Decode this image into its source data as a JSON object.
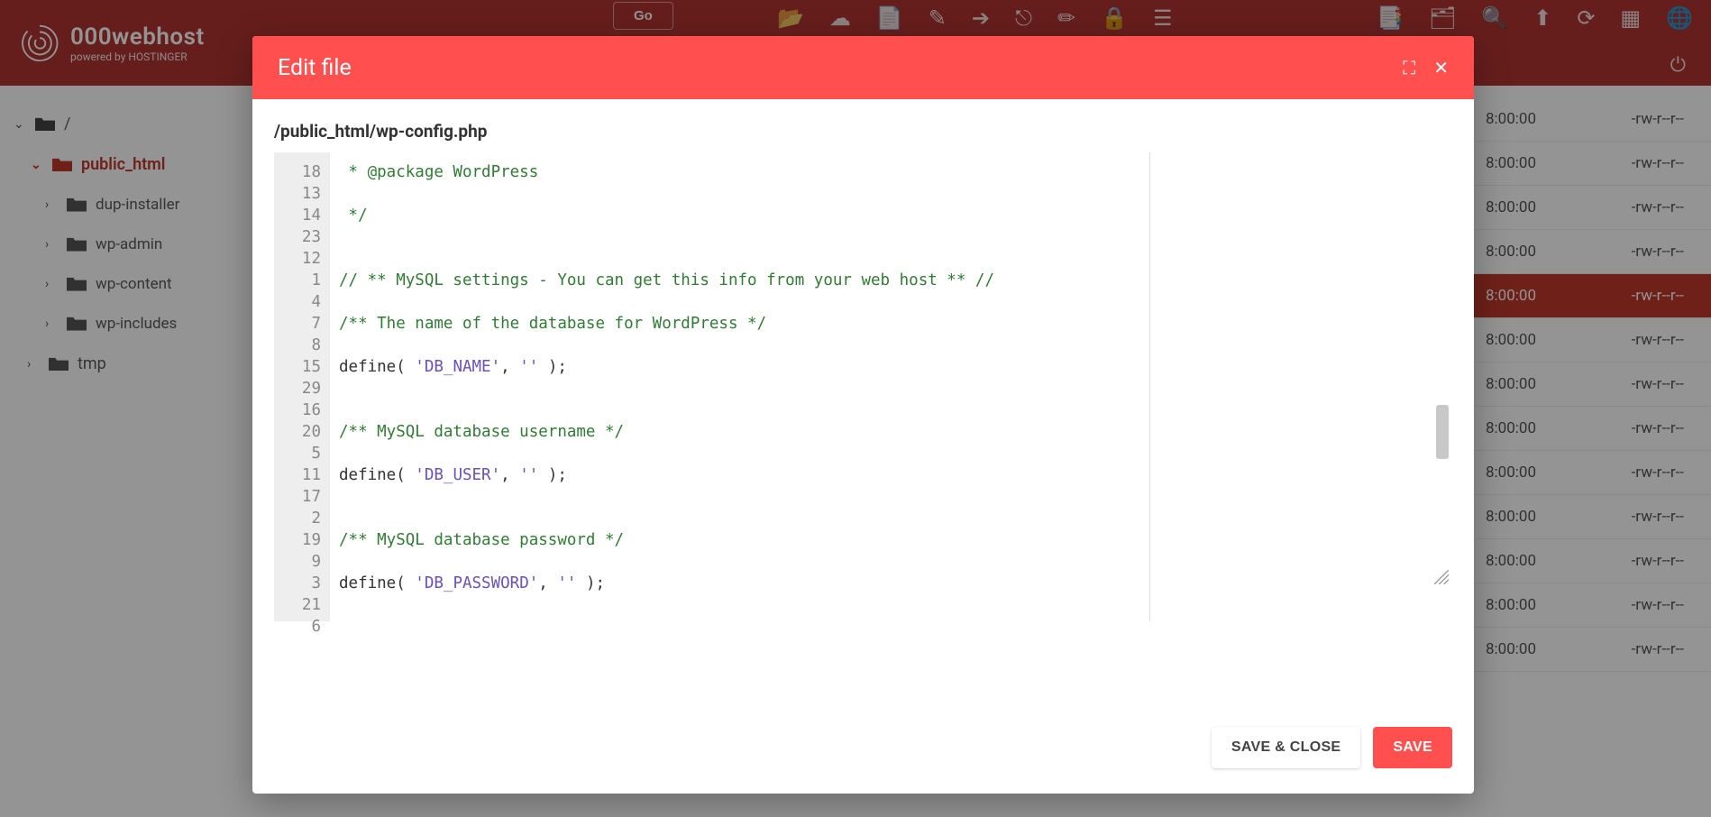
{
  "brand": {
    "name": "000webhost",
    "tagline": "powered by HOSTINGER"
  },
  "header": {
    "go": "Go"
  },
  "sidebar": {
    "root": "/",
    "active": "public_html",
    "children": [
      "dup-installer",
      "wp-admin",
      "wp-content",
      "wp-includes"
    ],
    "tmp": "tmp"
  },
  "file_rows": [
    {
      "time": "8:00:00",
      "perm": "-rw-r--r--",
      "selected": false
    },
    {
      "time": "8:00:00",
      "perm": "-rw-r--r--",
      "selected": false
    },
    {
      "time": "8:00:00",
      "perm": "-rw-r--r--",
      "selected": false
    },
    {
      "time": "8:00:00",
      "perm": "-rw-r--r--",
      "selected": false
    },
    {
      "time": "8:00:00",
      "perm": "-rw-r--r--",
      "selected": true
    },
    {
      "time": "8:00:00",
      "perm": "-rw-r--r--",
      "selected": false
    },
    {
      "time": "8:00:00",
      "perm": "-rw-r--r--",
      "selected": false
    },
    {
      "time": "8:00:00",
      "perm": "-rw-r--r--",
      "selected": false
    },
    {
      "time": "8:00:00",
      "perm": "-rw-r--r--",
      "selected": false
    },
    {
      "time": "8:00:00",
      "perm": "-rw-r--r--",
      "selected": false
    },
    {
      "time": "8:00:00",
      "perm": "-rw-r--r--",
      "selected": false
    },
    {
      "time": "8:00:00",
      "perm": "-rw-r--r--",
      "selected": false
    },
    {
      "time": "8:00:00",
      "perm": "-rw-r--r--",
      "selected": false
    }
  ],
  "modal": {
    "title": "Edit file",
    "path": "/public_html/wp-config.php",
    "save_close": "SAVE & CLOSE",
    "save": "SAVE"
  },
  "editor": {
    "line_numbers": [
      "18",
      "13",
      "14",
      "23",
      "12",
      "1",
      "4",
      "7",
      "8",
      "15",
      "29",
      "16",
      "20",
      "5",
      "11",
      "17",
      "2",
      "19",
      "9",
      "3",
      "21",
      "6"
    ],
    "lines": [
      {
        "cls": "c",
        "text": " * @package WordPress"
      },
      {
        "cls": "",
        "text": ""
      },
      {
        "cls": "c",
        "text": " */"
      },
      {
        "cls": "",
        "text": ""
      },
      {
        "cls": "",
        "text": ""
      },
      {
        "cls": "c",
        "text": "// ** MySQL settings - You can get this info from your web host ** //"
      },
      {
        "cls": "",
        "text": ""
      },
      {
        "cls": "c",
        "text": "/** The name of the database for WordPress */"
      },
      {
        "cls": "",
        "text": ""
      },
      {
        "cls": "def",
        "text": [
          "define( ",
          "'DB_NAME'",
          ", ",
          "''",
          " );"
        ]
      },
      {
        "cls": "",
        "text": ""
      },
      {
        "cls": "",
        "text": ""
      },
      {
        "cls": "c",
        "text": "/** MySQL database username */"
      },
      {
        "cls": "",
        "text": ""
      },
      {
        "cls": "def",
        "text": [
          "define( ",
          "'DB_USER'",
          ", ",
          "''",
          " );"
        ]
      },
      {
        "cls": "",
        "text": ""
      },
      {
        "cls": "",
        "text": ""
      },
      {
        "cls": "c",
        "text": "/** MySQL database password */"
      },
      {
        "cls": "",
        "text": ""
      },
      {
        "cls": "def",
        "text": [
          "define( ",
          "'DB_PASSWORD'",
          ", ",
          "''",
          " );"
        ]
      },
      {
        "cls": "",
        "text": ""
      },
      {
        "cls": "",
        "text": ""
      }
    ]
  },
  "icons": {
    "toolbar": [
      "folder-open-icon",
      "cloud-upload-icon",
      "file-icon",
      "edit-square-icon",
      "arrow-right-icon",
      "export-icon",
      "pencil-icon",
      "briefcase-icon",
      "list-icon"
    ],
    "toolbar_right": [
      "file-export-icon",
      "folder-transfer-icon",
      "search-icon",
      "upload-icon",
      "refresh-icon",
      "grid-icon",
      "globe-icon"
    ]
  }
}
